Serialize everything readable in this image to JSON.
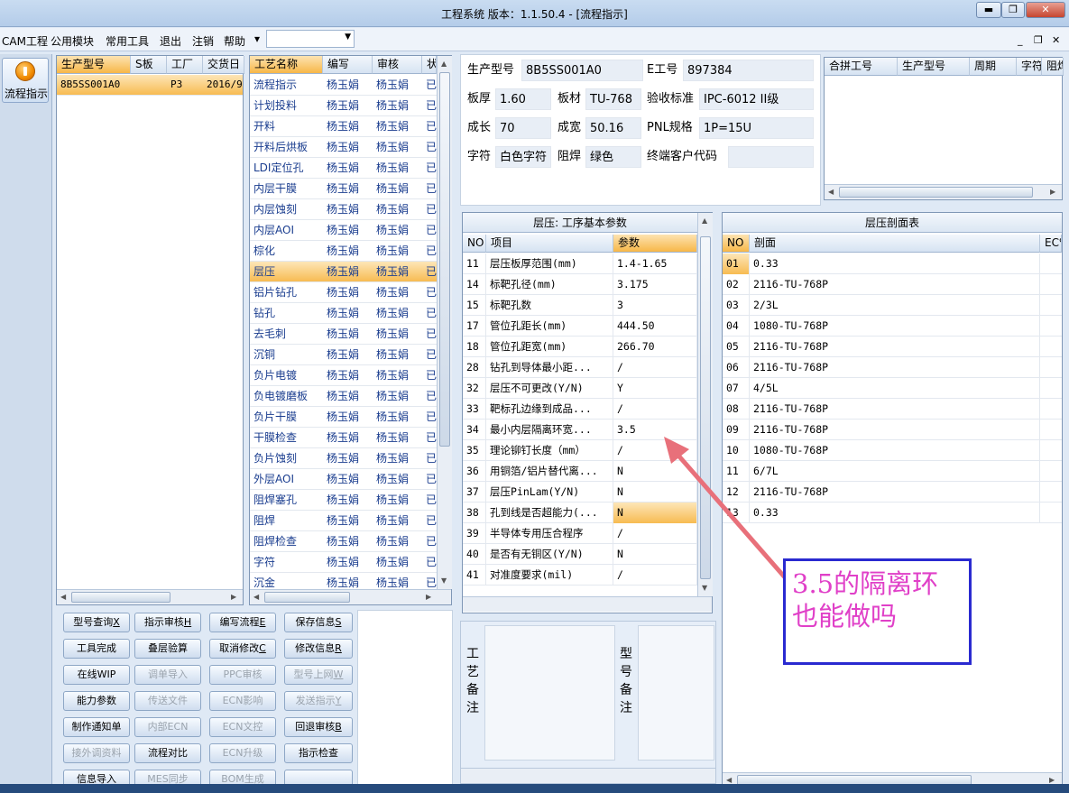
{
  "window": {
    "caption": "",
    "title": "工程系统   版本：1.1.50.4 - [流程指示]",
    "controls": {
      "minimize": "▬",
      "restore": "❐",
      "close": "✕"
    }
  },
  "menu": {
    "items": [
      "CAM工程",
      "公用模块",
      "常用工具",
      "退出",
      "注销",
      "帮助"
    ],
    "overflow": "▾",
    "combo_value": "",
    "mdi": {
      "minimize": "_",
      "restore": "❐",
      "close": "✕"
    }
  },
  "leftnav": {
    "flow_label": "流程指示"
  },
  "orders": {
    "headers": [
      "生产型号",
      "S板",
      "工厂",
      "交货日"
    ],
    "rows": [
      [
        "8B5SS001A0",
        "",
        "P3",
        "2016/9"
      ]
    ]
  },
  "process": {
    "headers": [
      "工艺名称",
      "编写",
      "审核",
      "状"
    ],
    "rows": [
      [
        "流程指示",
        "杨玉娟",
        "杨玉娟",
        "已"
      ],
      [
        "计划投料",
        "杨玉娟",
        "杨玉娟",
        "已"
      ],
      [
        "开料",
        "杨玉娟",
        "杨玉娟",
        "已"
      ],
      [
        "开料后烘板",
        "杨玉娟",
        "杨玉娟",
        "已"
      ],
      [
        "LDI定位孔",
        "杨玉娟",
        "杨玉娟",
        "已"
      ],
      [
        "内层干膜",
        "杨玉娟",
        "杨玉娟",
        "已"
      ],
      [
        "内层蚀刻",
        "杨玉娟",
        "杨玉娟",
        "已"
      ],
      [
        "内层AOI",
        "杨玉娟",
        "杨玉娟",
        "已"
      ],
      [
        "棕化",
        "杨玉娟",
        "杨玉娟",
        "已"
      ],
      [
        "层压",
        "杨玉娟",
        "杨玉娟",
        "已"
      ],
      [
        "铝片钻孔",
        "杨玉娟",
        "杨玉娟",
        "已"
      ],
      [
        "钻孔",
        "杨玉娟",
        "杨玉娟",
        "已"
      ],
      [
        "去毛刺",
        "杨玉娟",
        "杨玉娟",
        "已"
      ],
      [
        "沉铜",
        "杨玉娟",
        "杨玉娟",
        "已"
      ],
      [
        "负片电镀",
        "杨玉娟",
        "杨玉娟",
        "已"
      ],
      [
        "负电镀磨板",
        "杨玉娟",
        "杨玉娟",
        "已"
      ],
      [
        "负片干膜",
        "杨玉娟",
        "杨玉娟",
        "已"
      ],
      [
        "干膜检查",
        "杨玉娟",
        "杨玉娟",
        "已"
      ],
      [
        "负片蚀刻",
        "杨玉娟",
        "杨玉娟",
        "已"
      ],
      [
        "外层AOI",
        "杨玉娟",
        "杨玉娟",
        "已"
      ],
      [
        "阻焊塞孔",
        "杨玉娟",
        "杨玉娟",
        "已"
      ],
      [
        "阻焊",
        "杨玉娟",
        "杨玉娟",
        "已"
      ],
      [
        "阻焊检查",
        "杨玉娟",
        "杨玉娟",
        "已"
      ],
      [
        "字符",
        "杨玉娟",
        "杨玉娟",
        "已"
      ],
      [
        "沉金",
        "杨玉娟",
        "杨玉娟",
        "已"
      ]
    ],
    "selected_index": 9
  },
  "info": {
    "part_no_label": "生产型号",
    "part_no": "8B5SS001A0",
    "e_no_label": "E工号",
    "e_no": "897384",
    "thickness_label": "板厚",
    "thickness": "1.60",
    "material_label": "板材",
    "material": "TU-768",
    "standard_label": "验收标准",
    "standard": "IPC-6012 II级",
    "length_label": "成长",
    "length": "70",
    "width_label": "成宽",
    "width": "50.16",
    "pnl_label": "PNL规格",
    "pnl": "1P=15U",
    "char_label": "字符",
    "char": "白色字符",
    "mask_label": "阻焊",
    "mask": "绿色",
    "customer_label": "终端客户代码",
    "customer": ""
  },
  "merge": {
    "headers": [
      "合拼工号",
      "生产型号",
      "周期",
      "字符",
      "阻焊"
    ]
  },
  "params": {
    "title": "层压: 工序基本参数",
    "headers": [
      "NO",
      "项目",
      "参数"
    ],
    "rows": [
      [
        "11",
        "层压板厚范围(mm)",
        "1.4-1.65"
      ],
      [
        "14",
        "标靶孔径(mm)",
        "3.175"
      ],
      [
        "15",
        "标靶孔数",
        "3"
      ],
      [
        "17",
        "管位孔距长(mm)",
        "444.50"
      ],
      [
        "18",
        "管位孔距宽(mm)",
        "266.70"
      ],
      [
        "28",
        "钻孔到导体最小距...",
        "/"
      ],
      [
        "32",
        "层压不可更改(Y/N)",
        "Y"
      ],
      [
        "33",
        "靶标孔边缘到成品...",
        "/"
      ],
      [
        "34",
        "最小内层隔离环宽...",
        "3.5"
      ],
      [
        "35",
        "理论铆钉长度（mm）",
        "/"
      ],
      [
        "36",
        "用铜箔/铝片替代离...",
        "N"
      ],
      [
        "37",
        "层压PinLam(Y/N)",
        "N"
      ],
      [
        "38",
        "孔到线是否超能力(...",
        "N"
      ],
      [
        "39",
        "半导体专用压合程序",
        "/"
      ],
      [
        "40",
        "是否有无铜区(Y/N)",
        "N"
      ],
      [
        "41",
        "对准度要求(mil)",
        "/"
      ]
    ],
    "selected_index": 12
  },
  "stack": {
    "title": "层压剖面表",
    "headers": [
      "NO",
      "剖面",
      "EC%"
    ],
    "rows": [
      [
        "01",
        "0.33"
      ],
      [
        "02",
        "2116-TU-768P"
      ],
      [
        "03",
        "2/3L"
      ],
      [
        "04",
        "1080-TU-768P"
      ],
      [
        "05",
        "2116-TU-768P"
      ],
      [
        "06",
        "2116-TU-768P"
      ],
      [
        "07",
        "4/5L"
      ],
      [
        "08",
        "2116-TU-768P"
      ],
      [
        "09",
        "2116-TU-768P"
      ],
      [
        "10",
        "1080-TU-768P"
      ],
      [
        "11",
        "6/7L"
      ],
      [
        "12",
        "2116-TU-768P"
      ],
      [
        "13",
        "0.33"
      ]
    ],
    "selected_index": 0
  },
  "buttons": [
    [
      {
        "label": "型号查询",
        "key": "X",
        "enabled": true
      },
      {
        "label": "指示审核",
        "key": "H",
        "enabled": true
      },
      {
        "label": "编写流程",
        "key": "E",
        "enabled": true
      },
      {
        "label": "保存信息",
        "key": "S",
        "enabled": true
      }
    ],
    [
      {
        "label": "工具完成",
        "key": "",
        "enabled": true
      },
      {
        "label": "叠层验算",
        "key": "",
        "enabled": true
      },
      {
        "label": "取消修改",
        "key": "C",
        "enabled": true
      },
      {
        "label": "修改信息",
        "key": "R",
        "enabled": true
      }
    ],
    [
      {
        "label": "在线WIP",
        "key": "",
        "enabled": true
      },
      {
        "label": "调单导入",
        "key": "",
        "enabled": false
      },
      {
        "label": "PPC审核",
        "key": "",
        "enabled": false
      },
      {
        "label": "型号上网",
        "key": "W",
        "enabled": false
      }
    ],
    [
      {
        "label": "能力参数",
        "key": "",
        "enabled": true
      },
      {
        "label": "传送文件",
        "key": "",
        "enabled": false
      },
      {
        "label": "ECN影响",
        "key": "",
        "enabled": false
      },
      {
        "label": "发送指示",
        "key": "Y",
        "enabled": false
      }
    ],
    [
      {
        "label": "制作通知单",
        "key": "",
        "enabled": true
      },
      {
        "label": "内部ECN",
        "key": "",
        "enabled": false
      },
      {
        "label": "ECN文控",
        "key": "",
        "enabled": false
      },
      {
        "label": "回退审核",
        "key": "B",
        "enabled": true
      }
    ],
    [
      {
        "label": "接外调资料",
        "key": "",
        "enabled": false
      },
      {
        "label": "流程对比",
        "key": "",
        "enabled": true
      },
      {
        "label": "ECN升级",
        "key": "",
        "enabled": false
      },
      {
        "label": "指示检查",
        "key": "",
        "enabled": true
      }
    ],
    [
      {
        "label": "信息导入",
        "key": "",
        "enabled": true
      },
      {
        "label": "MES同步",
        "key": "",
        "enabled": false
      },
      {
        "label": "BOM生成",
        "key": "",
        "enabled": false
      },
      {
        "label": "",
        "key": "",
        "enabled": true
      }
    ]
  ],
  "remarks": {
    "process_label": "工艺备注",
    "model_label": "型号备注"
  },
  "annotation": {
    "text_line1": "3.5的隔离环",
    "text_line2": "也能做吗",
    "color": "#e040c8",
    "border": "#2a2ad0",
    "arrow": "#e8707a"
  }
}
